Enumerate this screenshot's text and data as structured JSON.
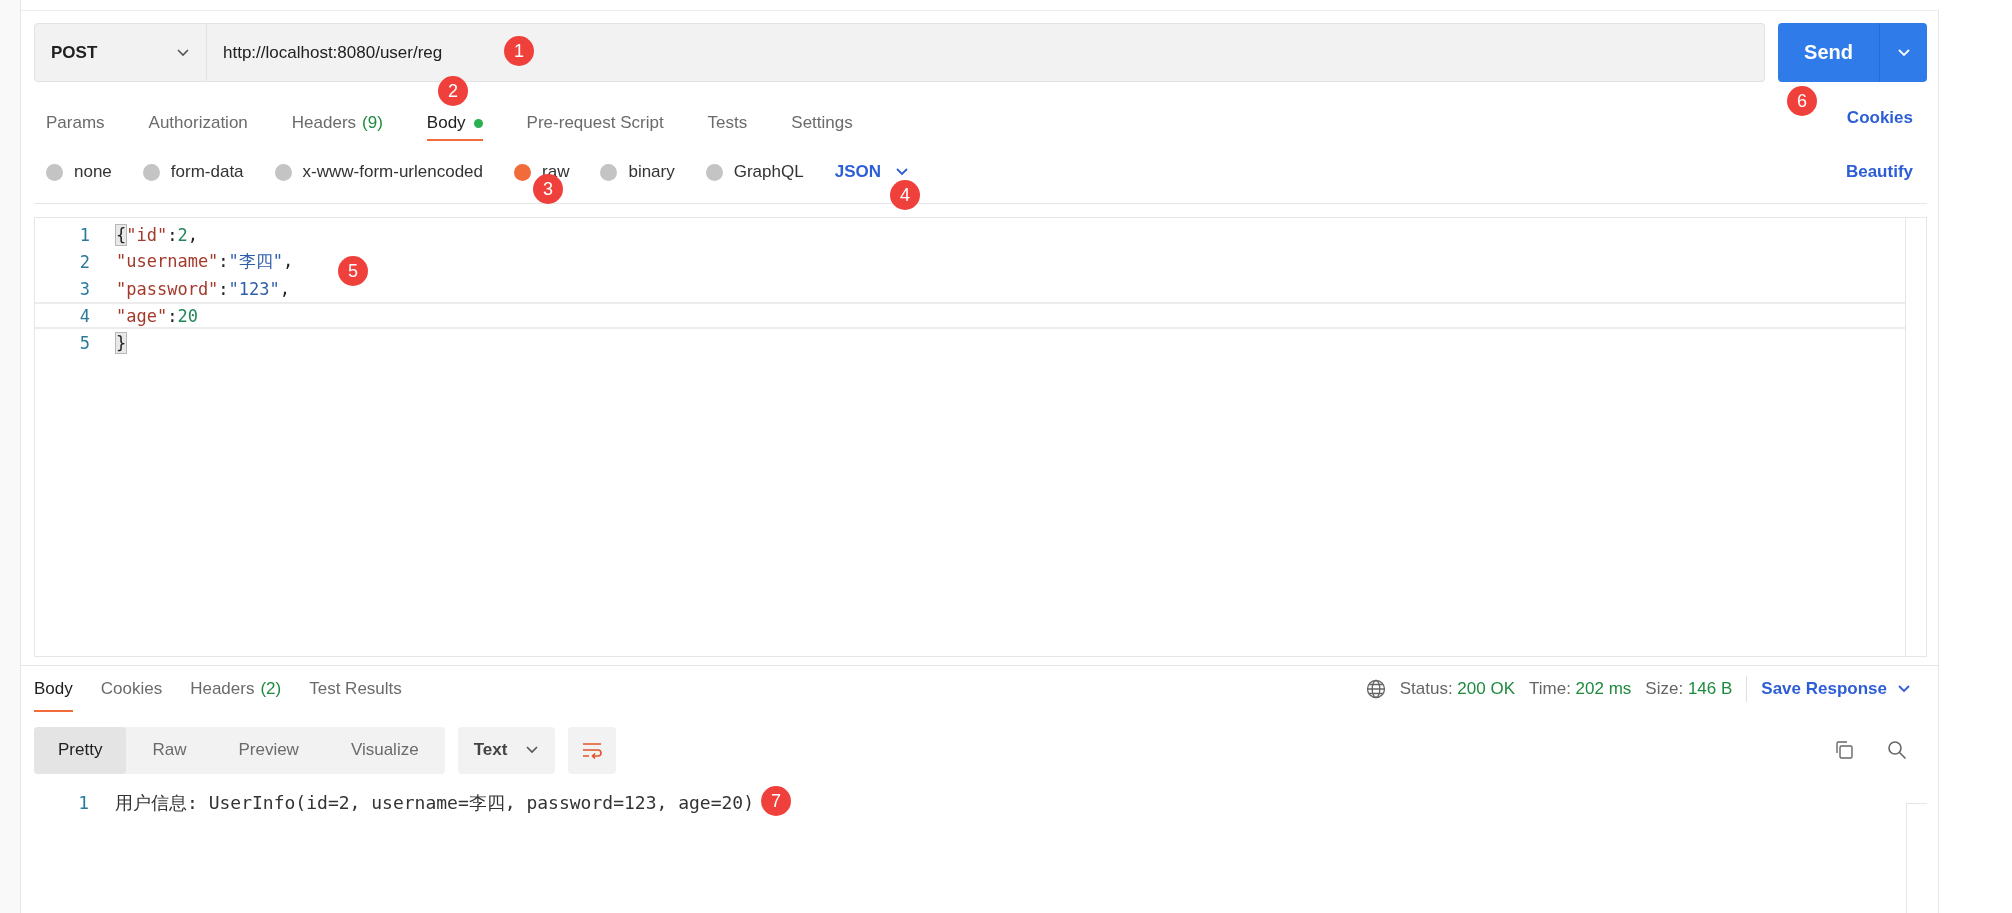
{
  "request": {
    "method": "POST",
    "url": "http://localhost:8080/user/reg",
    "send": "Send"
  },
  "request_tabs": [
    {
      "label": "Params",
      "selected": false
    },
    {
      "label": "Authorization",
      "selected": false
    },
    {
      "label": "Headers",
      "count": "(9)",
      "selected": false
    },
    {
      "label": "Body",
      "selected": true,
      "dot": true
    },
    {
      "label": "Pre-request Script",
      "selected": false
    },
    {
      "label": "Tests",
      "selected": false
    },
    {
      "label": "Settings",
      "selected": false
    }
  ],
  "cookies_link": "Cookies",
  "body_types": [
    {
      "label": "none",
      "selected": false
    },
    {
      "label": "form-data",
      "selected": false
    },
    {
      "label": "x-www-form-urlencoded",
      "selected": false
    },
    {
      "label": "raw",
      "selected": true
    },
    {
      "label": "binary",
      "selected": false
    },
    {
      "label": "GraphQL",
      "selected": false
    }
  ],
  "language": "JSON",
  "beautify": "Beautify",
  "editor": {
    "lines": [
      {
        "number": "1",
        "current": false,
        "tokens": [
          {
            "kind": "bracket",
            "text": "{"
          },
          {
            "kind": "key",
            "text": "\"id\""
          },
          {
            "kind": "punct",
            "text": ":"
          },
          {
            "kind": "number",
            "text": "2"
          },
          {
            "kind": "punct",
            "text": ","
          }
        ]
      },
      {
        "number": "2",
        "current": false,
        "tokens": [
          {
            "kind": "key",
            "text": "\"username\""
          },
          {
            "kind": "punct",
            "text": ":"
          },
          {
            "kind": "string",
            "text": "\"李四\""
          },
          {
            "kind": "punct",
            "text": ","
          }
        ]
      },
      {
        "number": "3",
        "current": false,
        "tokens": [
          {
            "kind": "key",
            "text": "\"password\""
          },
          {
            "kind": "punct",
            "text": ":"
          },
          {
            "kind": "string",
            "text": "\"123\""
          },
          {
            "kind": "punct",
            "text": ","
          }
        ]
      },
      {
        "number": "4",
        "current": true,
        "tokens": [
          {
            "kind": "key",
            "text": "\"age\""
          },
          {
            "kind": "punct",
            "text": ":"
          },
          {
            "kind": "number",
            "text": "20"
          }
        ]
      },
      {
        "number": "5",
        "current": false,
        "tokens": [
          {
            "kind": "bracket",
            "text": "}"
          }
        ]
      }
    ]
  },
  "response": {
    "tabs": [
      {
        "label": "Body",
        "selected": true
      },
      {
        "label": "Cookies",
        "selected": false
      },
      {
        "label": "Headers",
        "count": "(2)",
        "selected": false
      },
      {
        "label": "Test Results",
        "selected": false
      }
    ],
    "stats": [
      {
        "label": "Status:",
        "value": "200 OK"
      },
      {
        "label": "Time:",
        "value": "202 ms"
      },
      {
        "label": "Size:",
        "value": "146 B"
      }
    ],
    "save": "Save Response",
    "view_modes": [
      {
        "label": "Pretty",
        "selected": true
      },
      {
        "label": "Raw",
        "selected": false
      },
      {
        "label": "Preview",
        "selected": false
      },
      {
        "label": "Visualize",
        "selected": false
      }
    ],
    "format": "Text",
    "lines": [
      {
        "number": "1",
        "text": "用户信息: UserInfo(id=2, username=李四, password=123, age=20)"
      }
    ]
  },
  "annotations": [
    {
      "label": "1"
    },
    {
      "label": "2"
    },
    {
      "label": "3"
    },
    {
      "label": "4"
    },
    {
      "label": "5"
    },
    {
      "label": "6"
    },
    {
      "label": "7"
    }
  ]
}
